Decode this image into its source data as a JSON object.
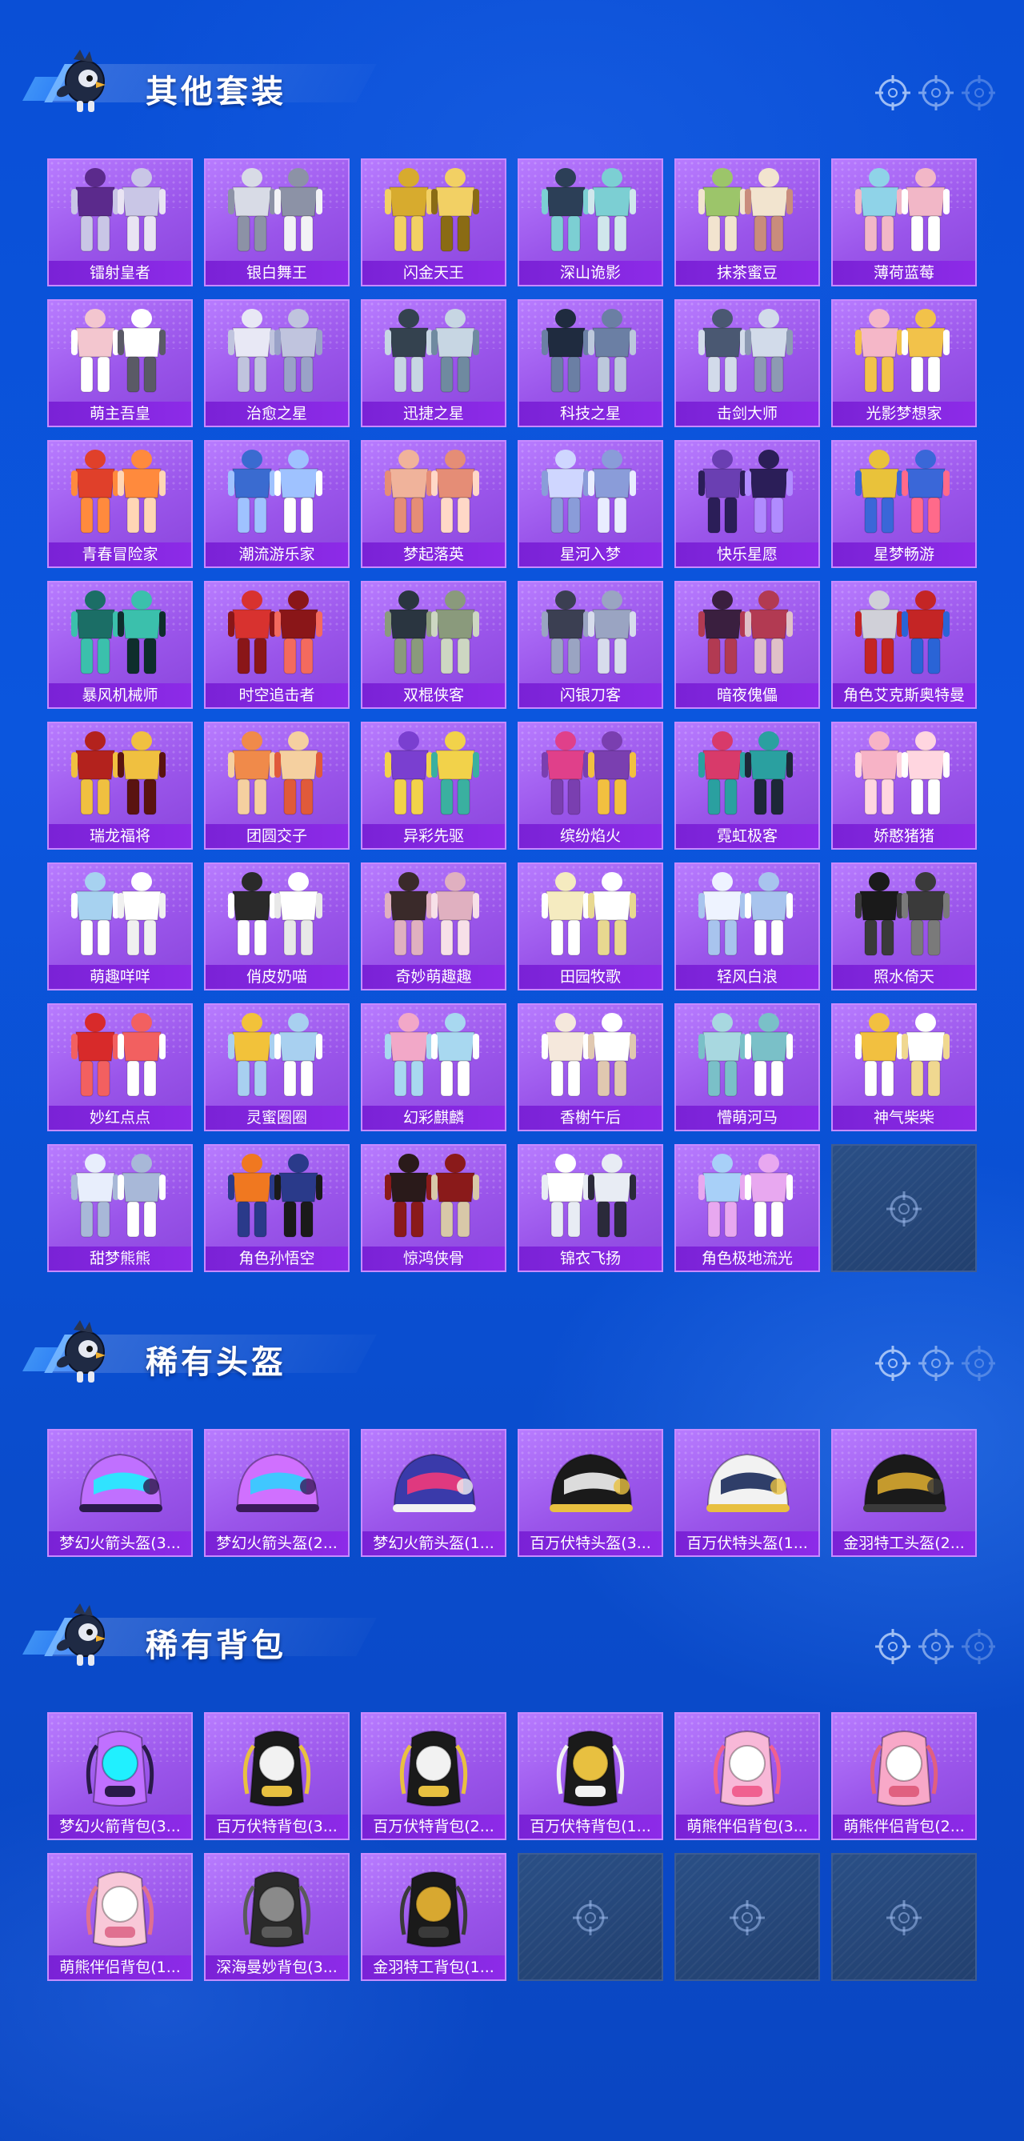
{
  "sections": [
    {
      "title": "其他套装",
      "items": [
        "镭射皇者",
        "银白舞王",
        "闪金天王",
        "深山诡影",
        "抹茶蜜豆",
        "薄荷蓝莓",
        "萌主吾皇",
        "治愈之星",
        "迅捷之星",
        "科技之星",
        "击剑大师",
        "光影梦想家",
        "青春冒险家",
        "潮流游乐家",
        "梦起落英",
        "星河入梦",
        "快乐星愿",
        "星梦畅游",
        "暴风机械师",
        "时空追击者",
        "双棍侠客",
        "闪银刀客",
        "暗夜傀儡",
        "角色艾克斯奥特曼",
        "瑞龙福将",
        "团圆交子",
        "异彩先驱",
        "缤纷焰火",
        "霓虹极客",
        "娇憨猪猪",
        "萌趣咩咩",
        "俏皮奶喵",
        "奇妙萌趣趣",
        "田园牧歌",
        "轻风白浪",
        "照水倚天",
        "妙红点点",
        "灵蜜圈圈",
        "幻彩麒麟",
        "香榭午后",
        "懵萌河马",
        "神气柴柴",
        "甜梦熊熊",
        "角色孙悟空",
        "惊鸿侠骨",
        "锦衣飞扬",
        "角色极地流光"
      ],
      "empty_slots": 1
    },
    {
      "title": "稀有头盔",
      "items": [
        "梦幻火箭头盔(3...",
        "梦幻火箭头盔(2...",
        "梦幻火箭头盔(1...",
        "百万伏特头盔(3...",
        "百万伏特头盔(1...",
        "金羽特工头盔(2..."
      ],
      "empty_slots": 0
    },
    {
      "title": "稀有背包",
      "items": [
        "梦幻火箭背包(3...",
        "百万伏特背包(3...",
        "百万伏特背包(2...",
        "百万伏特背包(1...",
        "萌熊伴侣背包(3...",
        "萌熊伴侣背包(2...",
        "萌熊伴侣背包(1...",
        "深海曼妙背包(3...",
        "金羽特工背包(1..."
      ],
      "empty_slots": 3
    }
  ],
  "icons": {
    "header_decoration": "target-crosshair-icon",
    "empty_slot": "target-crosshair-icon",
    "mascot": "chicken-mascot-icon"
  },
  "colors": {
    "background": "#0a4fd6",
    "card": "#9a55ea",
    "card_label": "#7a22d6",
    "empty_card": "#2a4f86"
  }
}
